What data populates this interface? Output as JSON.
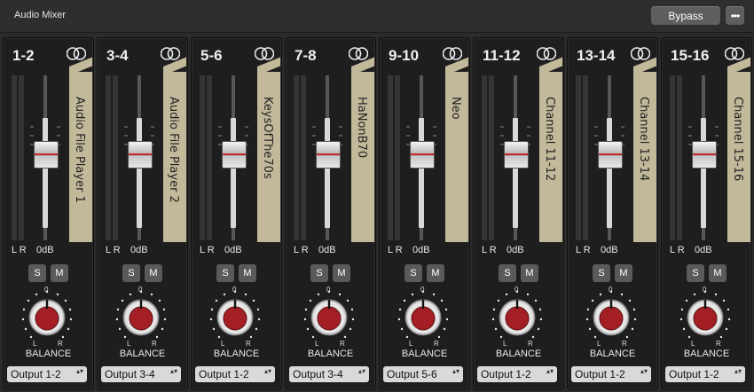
{
  "window": {
    "title": "Audio Mixer"
  },
  "toolbar": {
    "bypass_label": "Bypass",
    "more_label": "•••"
  },
  "common": {
    "meter_label": "L R",
    "gain_label": "0dB",
    "solo_label": "S",
    "mute_label": "M",
    "balance_zero": "0",
    "balance_left": "L",
    "balance_right": "R",
    "balance_label": "BALANCE",
    "select_arrows": "▴▾"
  },
  "channels": [
    {
      "label": "1-2",
      "name": "Audio File Player 1",
      "output": "Output 1-2",
      "fader_level": 0.5
    },
    {
      "label": "3-4",
      "name": "Audio File Player 2",
      "output": "Output 3-4",
      "fader_level": 0.5
    },
    {
      "label": "5-6",
      "name": "KeysOfThe70s",
      "output": "Output 1-2",
      "fader_level": 0.5
    },
    {
      "label": "7-8",
      "name": "HaNonB70",
      "output": "Output 3-4",
      "fader_level": 0.5
    },
    {
      "label": "9-10",
      "name": "Neo",
      "output": "Output 5-6",
      "fader_level": 0.5
    },
    {
      "label": "11-12",
      "name": "Channel 11-12",
      "output": "Output 1-2",
      "fader_level": 0.5
    },
    {
      "label": "13-14",
      "name": "Channel 13-14",
      "output": "Output 1-2",
      "fader_level": 0.5
    },
    {
      "label": "15-16",
      "name": "Channel 15-16",
      "output": "Output 1-2",
      "fader_level": 0.5
    }
  ]
}
